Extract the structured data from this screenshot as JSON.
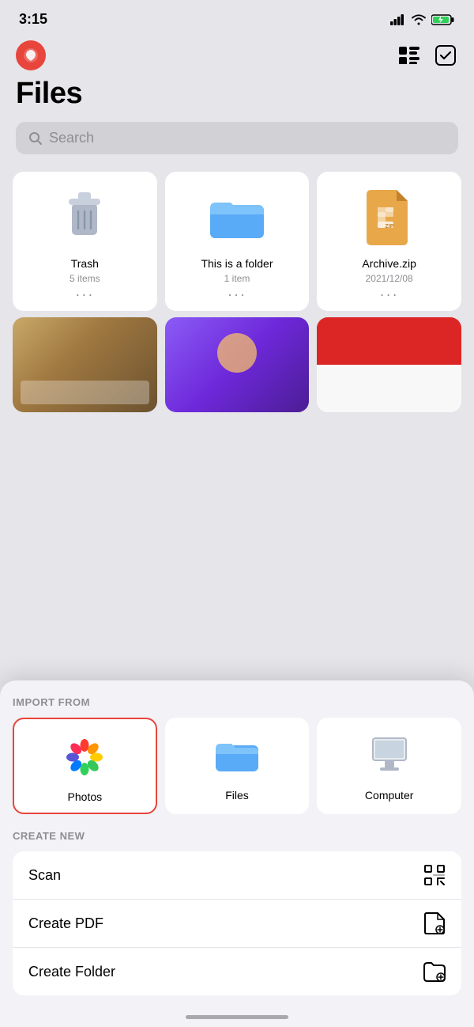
{
  "status": {
    "time": "3:15",
    "signal_bars": 4,
    "wifi": true,
    "battery_charging": true
  },
  "header": {
    "app_icon_label": "Pockity App",
    "list_view_label": "List View",
    "select_label": "Select"
  },
  "page": {
    "title": "Files",
    "search_placeholder": "Search"
  },
  "files": [
    {
      "name": "Trash",
      "meta": "5 items",
      "type": "trash"
    },
    {
      "name": "This is a folder",
      "meta": "1 item",
      "type": "folder"
    },
    {
      "name": "Archive.zip",
      "meta": "2021/12/08",
      "type": "zip"
    }
  ],
  "thumbnails": [
    {
      "label": "receipt-photo",
      "style": "thumb1"
    },
    {
      "label": "event-photo",
      "style": "thumb2"
    },
    {
      "label": "app-screenshot",
      "style": "thumb3"
    }
  ],
  "bottom_sheet": {
    "import_section_label": "IMPORT FROM",
    "import_items": [
      {
        "id": "photos",
        "label": "Photos",
        "selected": true
      },
      {
        "id": "files",
        "label": "Files",
        "selected": false
      },
      {
        "id": "computer",
        "label": "Computer",
        "selected": false
      }
    ],
    "create_section_label": "CREATE NEW",
    "create_items": [
      {
        "id": "scan",
        "label": "Scan"
      },
      {
        "id": "create-pdf",
        "label": "Create PDF"
      },
      {
        "id": "create-folder",
        "label": "Create Folder"
      }
    ]
  }
}
